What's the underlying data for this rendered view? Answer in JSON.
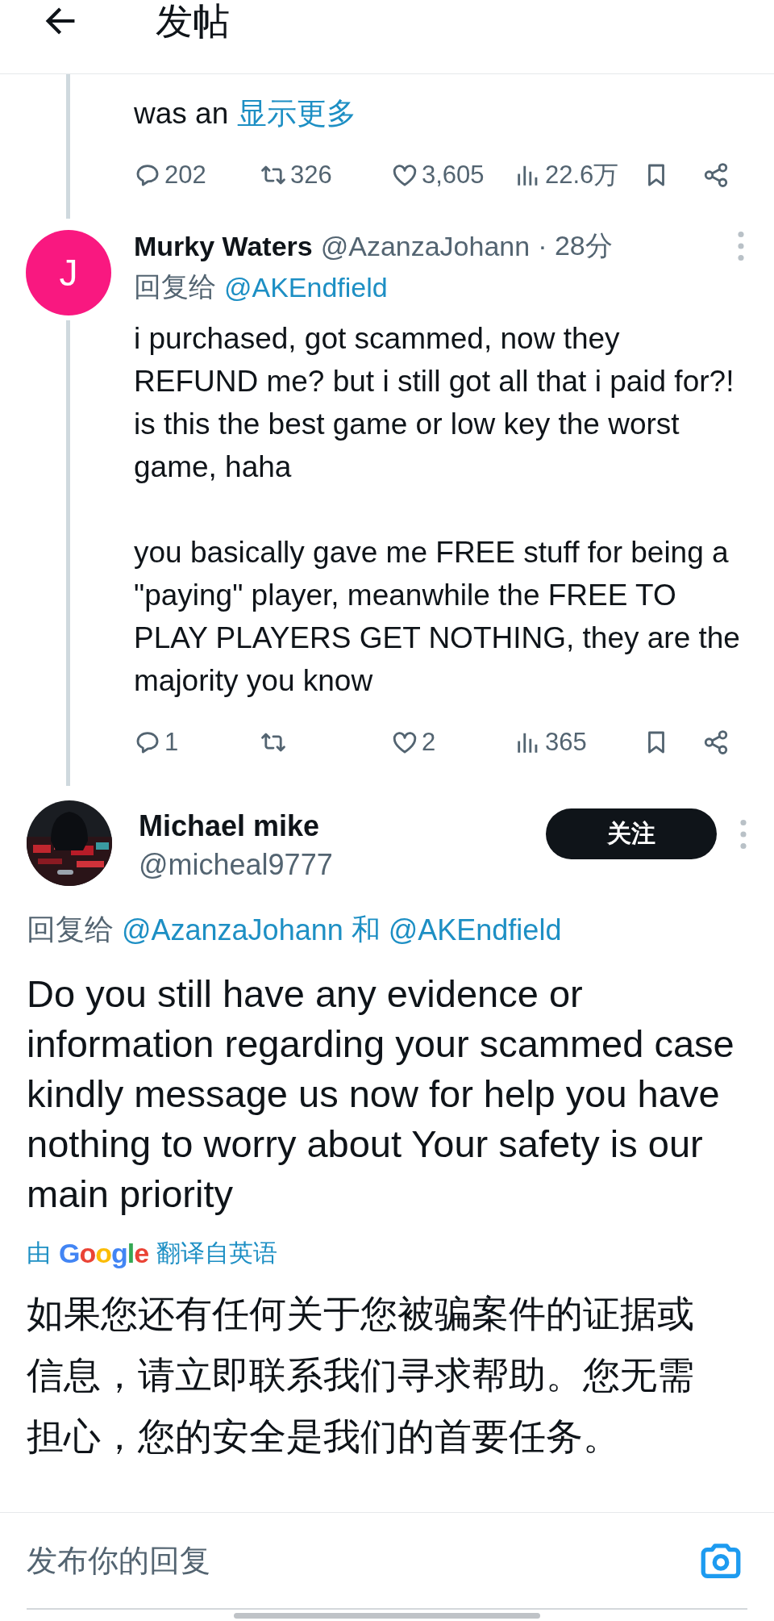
{
  "header": {
    "title": "发帖"
  },
  "top_post": {
    "text_tail": "was an",
    "show_more": "显示更多",
    "actions": {
      "replies": "202",
      "reposts": "326",
      "likes": "3,605",
      "views": "22.6万"
    }
  },
  "reply": {
    "avatar_letter": "J",
    "name": "Murky Waters",
    "handle": "@AzanzaJohann",
    "time": "· 28分",
    "reply_to_label": "回复给",
    "reply_to": [
      "@AKEndfield"
    ],
    "paragraphs": [
      "i purchased, got scammed, now they REFUND me? but i still got all that i paid for?! is this the best game or low key the worst game, haha",
      "you basically gave me FREE stuff for being a \"paying\" player, meanwhile the FREE TO PLAY PLAYERS GET NOTHING, they are the majority you know"
    ],
    "actions": {
      "replies": "1",
      "likes": "2",
      "views": "365"
    }
  },
  "focused": {
    "name": "Michael mike",
    "handle": "@micheal9777",
    "follow": "关注",
    "reply_to_label": "回复给",
    "reply_to": [
      "@AzanzaJohann",
      "@AKEndfield"
    ],
    "joiner": "和",
    "text": "Do you still have any evidence or information regarding your scammed case kindly message us now for help you have nothing to worry about Your safety is our main priority",
    "translation": {
      "by": "由",
      "brand": "Google",
      "label": "翻译自英语",
      "text": "如果您还有任何关于您被骗案件的证据或信息，请立即联系我们寻求帮助。您无需担心，您的安全是我们的首要任务。"
    }
  },
  "composer": {
    "placeholder": "发布你的回复"
  }
}
